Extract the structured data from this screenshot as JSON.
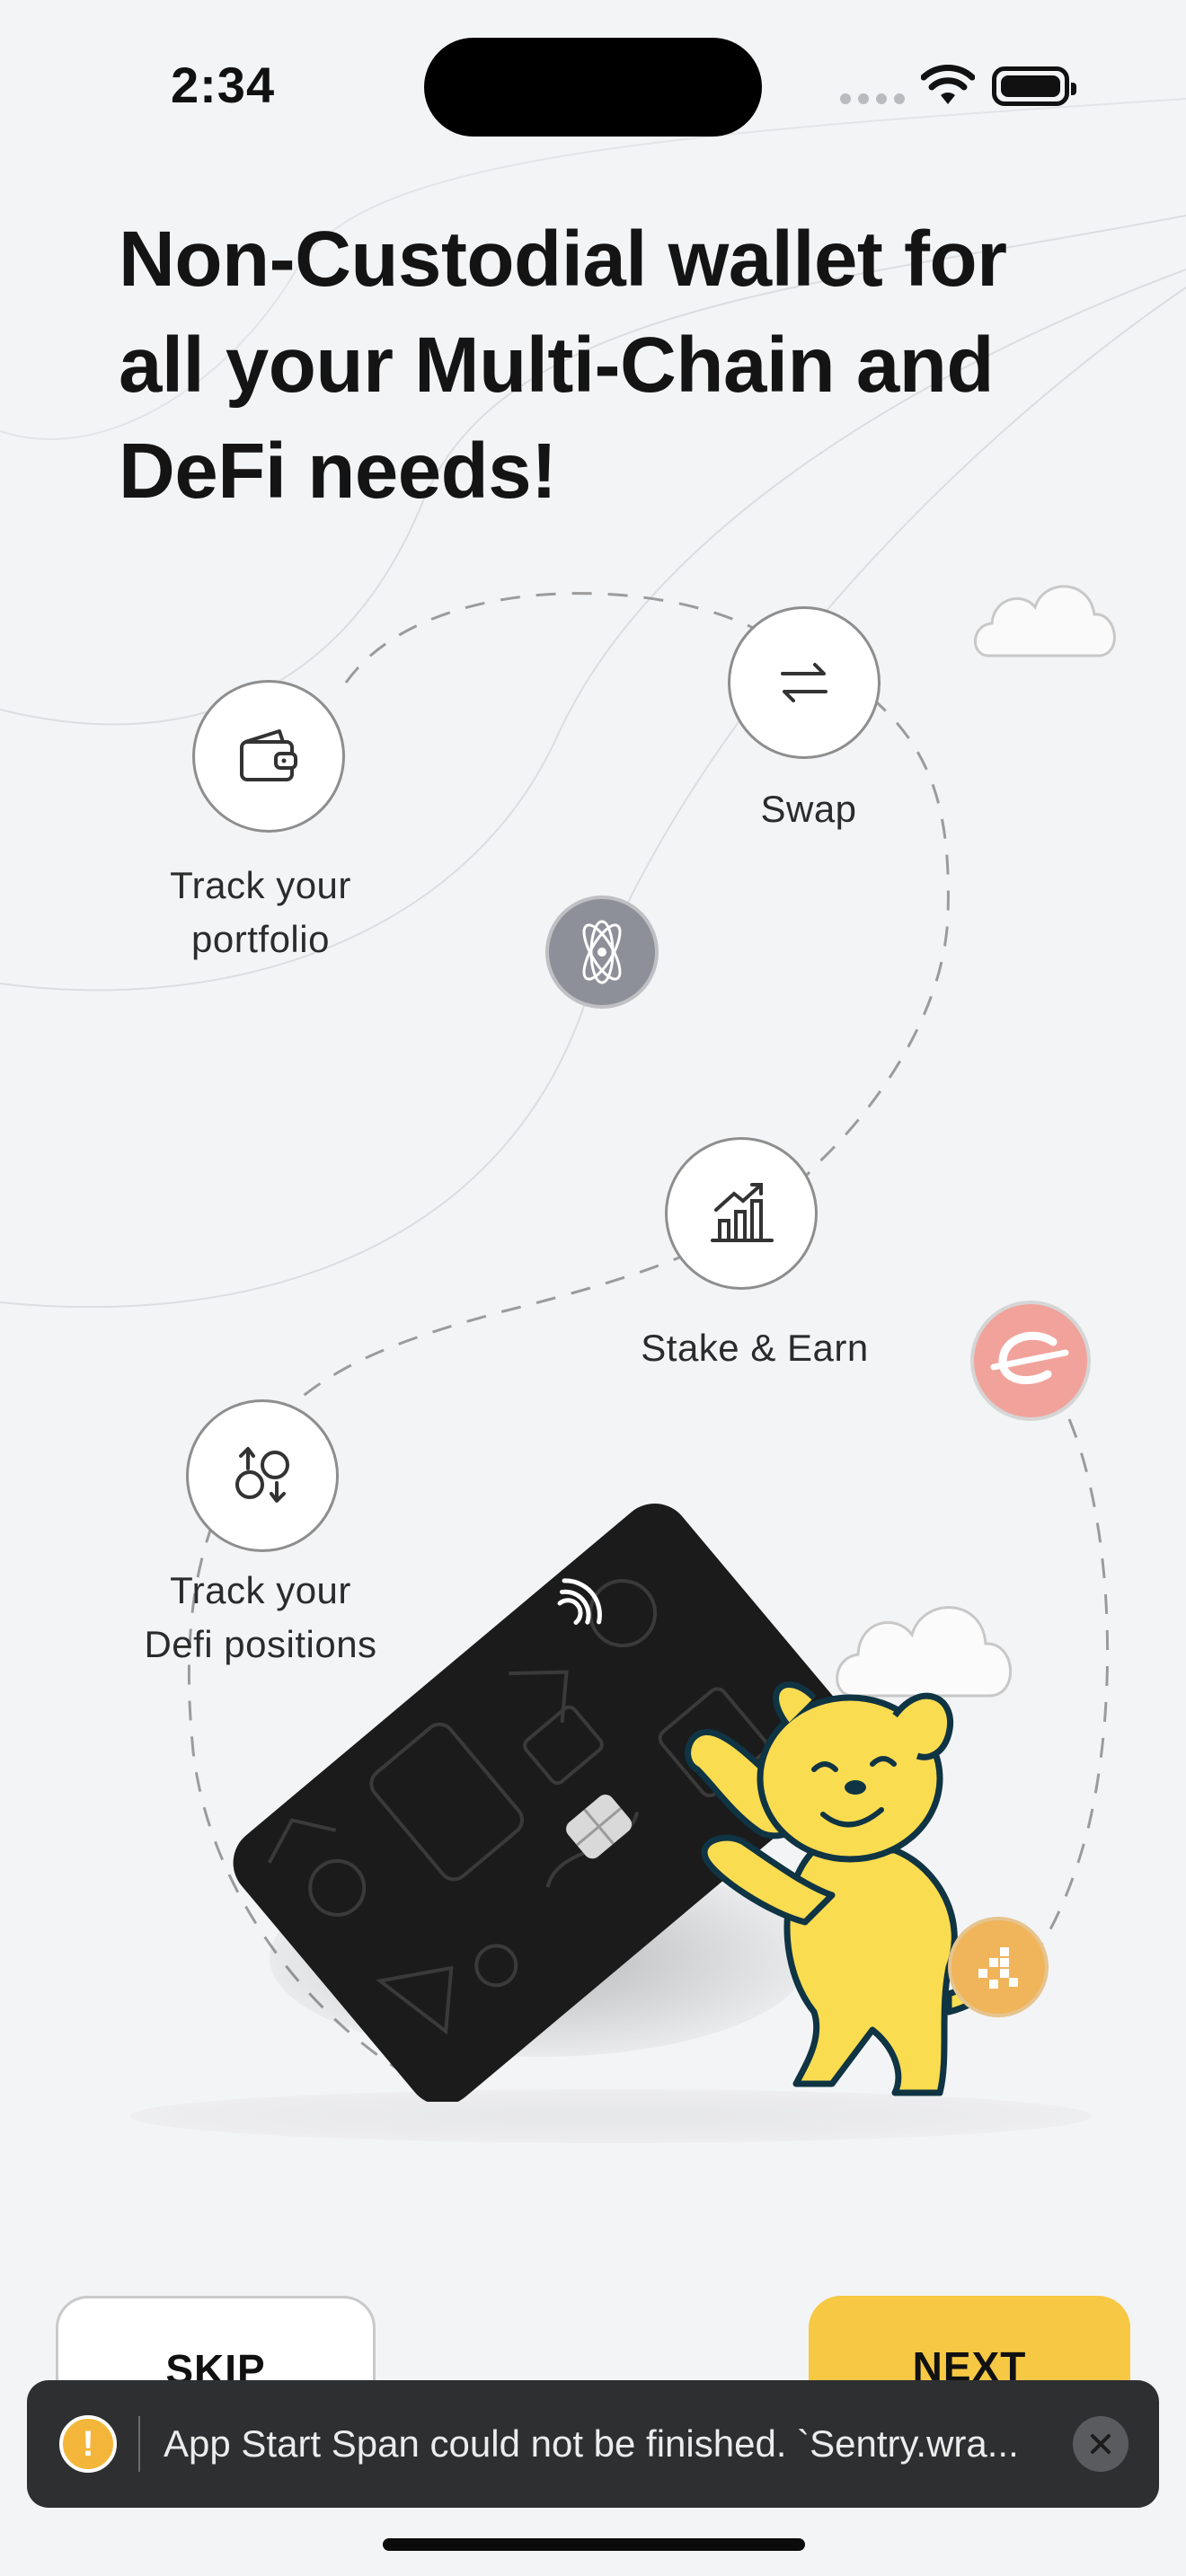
{
  "status_bar": {
    "time": "2:34"
  },
  "headline": "Non-Custodial wallet for all your Multi-Chain and DeFi needs!",
  "features": [
    {
      "label_line1": "Track your",
      "label_line2": "portfolio",
      "icon": "wallet-icon"
    },
    {
      "label_line1": "Swap",
      "icon": "swap-arrows-icon"
    },
    {
      "label_line1": "Stake & Earn",
      "icon": "bar-chart-icon"
    },
    {
      "label_line1": "Track your",
      "label_line2": "Defi positions",
      "icon": "defi-positions-icon"
    }
  ],
  "tokens": [
    {
      "name": "cosmos-token",
      "color": "#8e9099"
    },
    {
      "name": "elrond-token",
      "color": "#f1a39b"
    },
    {
      "name": "coin-token",
      "color": "#f0b45a"
    }
  ],
  "buttons": {
    "skip": "SKIP",
    "next": "NEXT"
  },
  "toast": {
    "message": "App Start Span could not be finished. `Sentry.wra..."
  },
  "colors": {
    "accent": "#f6c843",
    "background": "#f3f4f6",
    "toast_bg": "#2e2f31",
    "warning": "#f4b63a"
  }
}
